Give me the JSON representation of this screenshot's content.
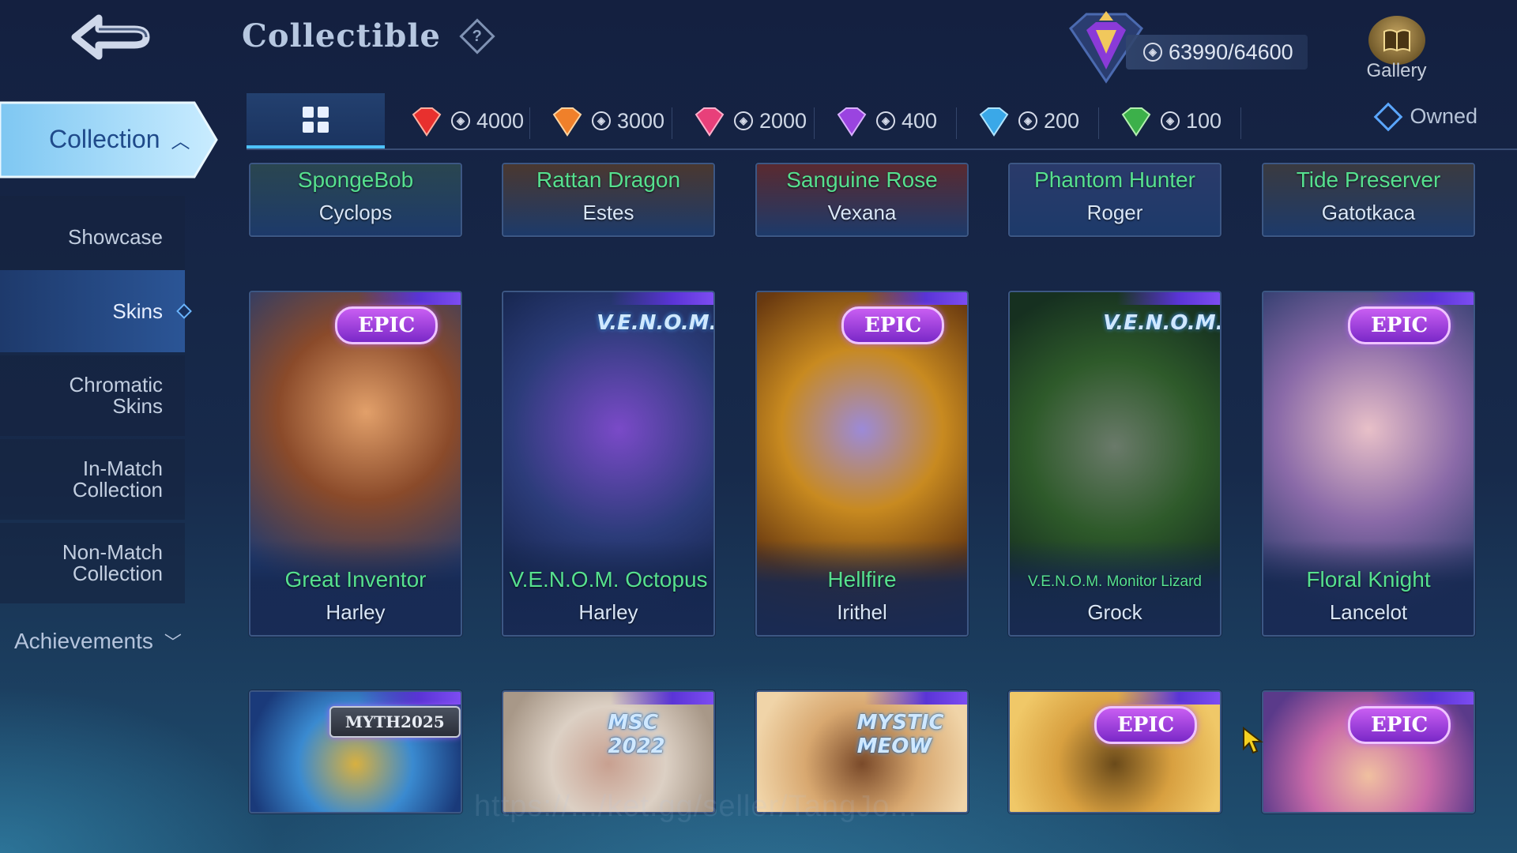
{
  "header": {
    "title": "Collectible",
    "help_icon": "question-diamond-icon",
    "points": "63990/64600",
    "gallery_label": "Gallery"
  },
  "sidebar": {
    "collection_label": "Collection",
    "items": [
      {
        "label": "Showcase",
        "active": false
      },
      {
        "label": "Skins",
        "active": true
      },
      {
        "label": "Chromatic\nSkins",
        "active": false
      },
      {
        "label": "In-Match\nCollection",
        "active": false
      },
      {
        "label": "Non-Match\nCollection",
        "active": false
      }
    ],
    "achievements_label": "Achievements"
  },
  "tabs": [
    {
      "type": "all",
      "icon": "grid-icon"
    },
    {
      "value": "4000",
      "gem_color": "#e8302e"
    },
    {
      "value": "3000",
      "gem_color": "#f0802a"
    },
    {
      "value": "2000",
      "gem_color": "#e8407a"
    },
    {
      "value": "400",
      "gem_color": "#9a44e0"
    },
    {
      "value": "200",
      "gem_color": "#3aa8e8"
    },
    {
      "value": "100",
      "gem_color": "#3cb04a"
    }
  ],
  "owned_label": "Owned",
  "cards_row1": [
    {
      "skin": "SpongeBob",
      "hero": "Cyclops"
    },
    {
      "skin": "Rattan Dragon",
      "hero": "Estes"
    },
    {
      "skin": "Sanguine Rose",
      "hero": "Vexana"
    },
    {
      "skin": "Phantom Hunter",
      "hero": "Roger"
    },
    {
      "skin": "Tide Preserver",
      "hero": "Gatotkaca"
    }
  ],
  "cards_row2": [
    {
      "skin": "Great Inventor",
      "hero": "Harley",
      "badge": "EPIC",
      "badge_type": "epic"
    },
    {
      "skin": "V.E.N.O.M. Octopus",
      "hero": "Harley",
      "badge": "V.E.N.O.M.",
      "badge_type": "logo"
    },
    {
      "skin": "Hellfire",
      "hero": "Irithel",
      "badge": "EPIC",
      "badge_type": "epic"
    },
    {
      "skin": "V.E.N.O.M. Monitor Lizard",
      "hero": "Grock",
      "badge": "V.E.N.O.M.",
      "badge_type": "logo"
    },
    {
      "skin": "Floral Knight",
      "hero": "Lancelot",
      "badge": "EPIC",
      "badge_type": "epic"
    }
  ],
  "cards_row3": [
    {
      "badge": "MYTH2025",
      "badge_type": "tag"
    },
    {
      "badge": "MSC 2022",
      "badge_type": "logo"
    },
    {
      "badge": "MYSTIC MEOW",
      "badge_type": "logo"
    },
    {
      "badge": "EPIC",
      "badge_type": "epic"
    },
    {
      "badge": "EPIC",
      "badge_type": "epic"
    }
  ],
  "watermark": "https://.../ket.gg/seller/TangJo..."
}
